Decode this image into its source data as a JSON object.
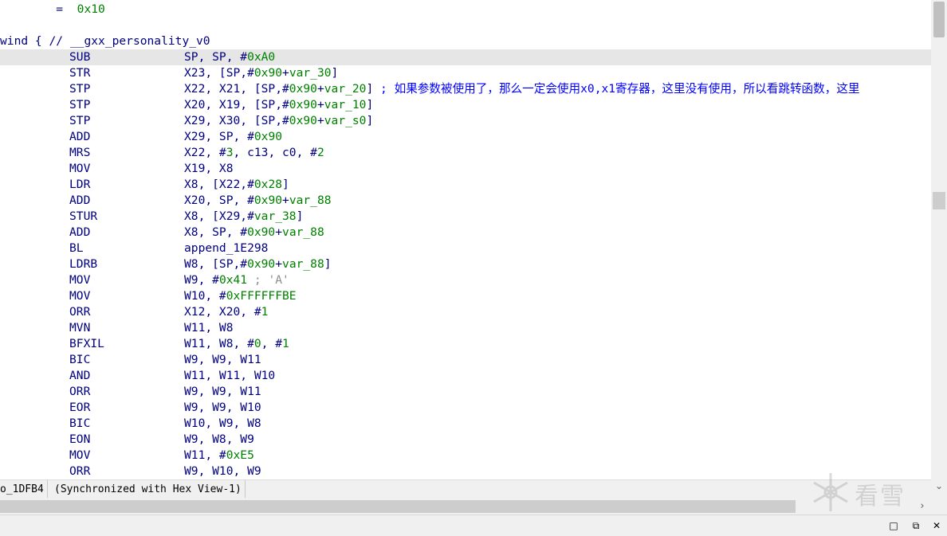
{
  "listing": {
    "lines": [
      {
        "segs": [
          {
            "t": "        =  ",
            "c": "plain"
          },
          {
            "t": "0x10",
            "c": "green"
          }
        ]
      },
      {
        "segs": []
      },
      {
        "segs": [
          {
            "t": "wind { // ",
            "c": "plain"
          },
          {
            "t": "__gxx_personality_v0",
            "c": "plain"
          }
        ]
      },
      {
        "mnem": "SUB",
        "ops": [
          {
            "t": "SP, SP, #",
            "c": "plain"
          },
          {
            "t": "0xA0",
            "c": "green"
          }
        ],
        "highlight": true
      },
      {
        "mnem": "STR",
        "ops": [
          {
            "t": "X23, [SP,#",
            "c": "plain"
          },
          {
            "t": "0x90",
            "c": "green"
          },
          {
            "t": "+",
            "c": "plain"
          },
          {
            "t": "var_30",
            "c": "green"
          },
          {
            "t": "]",
            "c": "plain"
          }
        ]
      },
      {
        "mnem": "STP",
        "ops": [
          {
            "t": "X22, X21, [SP,#",
            "c": "plain"
          },
          {
            "t": "0x90",
            "c": "green"
          },
          {
            "t": "+",
            "c": "plain"
          },
          {
            "t": "var_20",
            "c": "green"
          },
          {
            "t": "] ",
            "c": "plain"
          },
          {
            "t": "; 如果参数被使用了，那么一定会使用x0,x1寄存器，这里没有使用，所以看跳转函数，这里",
            "c": "cmt"
          }
        ]
      },
      {
        "mnem": "STP",
        "ops": [
          {
            "t": "X20, X19, [SP,#",
            "c": "plain"
          },
          {
            "t": "0x90",
            "c": "green"
          },
          {
            "t": "+",
            "c": "plain"
          },
          {
            "t": "var_10",
            "c": "green"
          },
          {
            "t": "]",
            "c": "plain"
          }
        ]
      },
      {
        "mnem": "STP",
        "ops": [
          {
            "t": "X29, X30, [SP,#",
            "c": "plain"
          },
          {
            "t": "0x90",
            "c": "green"
          },
          {
            "t": "+",
            "c": "plain"
          },
          {
            "t": "var_s0",
            "c": "green"
          },
          {
            "t": "]",
            "c": "plain"
          }
        ]
      },
      {
        "mnem": "ADD",
        "ops": [
          {
            "t": "X29, SP, #",
            "c": "plain"
          },
          {
            "t": "0x90",
            "c": "green"
          }
        ]
      },
      {
        "mnem": "MRS",
        "ops": [
          {
            "t": "X22, #",
            "c": "plain"
          },
          {
            "t": "3",
            "c": "green"
          },
          {
            "t": ", c13, c0, #",
            "c": "plain"
          },
          {
            "t": "2",
            "c": "green"
          }
        ]
      },
      {
        "mnem": "MOV",
        "ops": [
          {
            "t": "X19, X8",
            "c": "plain"
          }
        ]
      },
      {
        "mnem": "LDR",
        "ops": [
          {
            "t": "X8, [X22,#",
            "c": "plain"
          },
          {
            "t": "0x28",
            "c": "green"
          },
          {
            "t": "]",
            "c": "plain"
          }
        ]
      },
      {
        "mnem": "ADD",
        "ops": [
          {
            "t": "X20, SP, #",
            "c": "plain"
          },
          {
            "t": "0x90",
            "c": "green"
          },
          {
            "t": "+",
            "c": "plain"
          },
          {
            "t": "var_88",
            "c": "green"
          }
        ]
      },
      {
        "mnem": "STUR",
        "ops": [
          {
            "t": "X8, [X29,#",
            "c": "plain"
          },
          {
            "t": "var_38",
            "c": "green"
          },
          {
            "t": "]",
            "c": "plain"
          }
        ]
      },
      {
        "mnem": "ADD",
        "ops": [
          {
            "t": "X8, SP, #",
            "c": "plain"
          },
          {
            "t": "0x90",
            "c": "green"
          },
          {
            "t": "+",
            "c": "plain"
          },
          {
            "t": "var_88",
            "c": "green"
          }
        ]
      },
      {
        "mnem": "BL",
        "ops": [
          {
            "t": "append_1E298",
            "c": "plain"
          }
        ]
      },
      {
        "mnem": "LDRB",
        "ops": [
          {
            "t": "W8, [SP,#",
            "c": "plain"
          },
          {
            "t": "0x90",
            "c": "green"
          },
          {
            "t": "+",
            "c": "plain"
          },
          {
            "t": "var_88",
            "c": "green"
          },
          {
            "t": "]",
            "c": "plain"
          }
        ]
      },
      {
        "mnem": "MOV",
        "ops": [
          {
            "t": "W9, #",
            "c": "plain"
          },
          {
            "t": "0x41",
            "c": "green"
          },
          {
            "t": " ; 'A'",
            "c": "gray"
          }
        ]
      },
      {
        "mnem": "MOV",
        "ops": [
          {
            "t": "W10, #",
            "c": "plain"
          },
          {
            "t": "0xFFFFFFBE",
            "c": "green"
          }
        ]
      },
      {
        "mnem": "ORR",
        "ops": [
          {
            "t": "X12, X20, #",
            "c": "plain"
          },
          {
            "t": "1",
            "c": "green"
          }
        ]
      },
      {
        "mnem": "MVN",
        "ops": [
          {
            "t": "W11, W8",
            "c": "plain"
          }
        ]
      },
      {
        "mnem": "BFXIL",
        "ops": [
          {
            "t": "W11, W8, #",
            "c": "plain"
          },
          {
            "t": "0",
            "c": "green"
          },
          {
            "t": ", #",
            "c": "plain"
          },
          {
            "t": "1",
            "c": "green"
          }
        ]
      },
      {
        "mnem": "BIC",
        "ops": [
          {
            "t": "W9, W9, W11",
            "c": "plain"
          }
        ]
      },
      {
        "mnem": "AND",
        "ops": [
          {
            "t": "W11, W11, W10",
            "c": "plain"
          }
        ]
      },
      {
        "mnem": "ORR",
        "ops": [
          {
            "t": "W9, W9, W11",
            "c": "plain"
          }
        ]
      },
      {
        "mnem": "EOR",
        "ops": [
          {
            "t": "W9, W9, W10",
            "c": "plain"
          }
        ]
      },
      {
        "mnem": "BIC",
        "ops": [
          {
            "t": "W10, W9, W8",
            "c": "plain"
          }
        ]
      },
      {
        "mnem": "EON",
        "ops": [
          {
            "t": "W9, W8, W9",
            "c": "plain"
          }
        ]
      },
      {
        "mnem": "MOV",
        "ops": [
          {
            "t": "W11, #",
            "c": "plain"
          },
          {
            "t": "0xE5",
            "c": "green"
          }
        ]
      },
      {
        "mnem": "ORR",
        "ops": [
          {
            "t": "W9, W10, W9",
            "c": "plain"
          }
        ]
      }
    ]
  },
  "statusbar": {
    "location": "o_1DFB4",
    "sync": "(Synchronized with Hex View-1)"
  },
  "scroll": {
    "down_arrow": "⌄",
    "right_arrow": "›"
  },
  "window_controls": {
    "minimize": "□",
    "restore": "⧉",
    "close": "✕"
  },
  "watermark": {
    "text": "看雪",
    "icon": "snowflake-icon"
  }
}
